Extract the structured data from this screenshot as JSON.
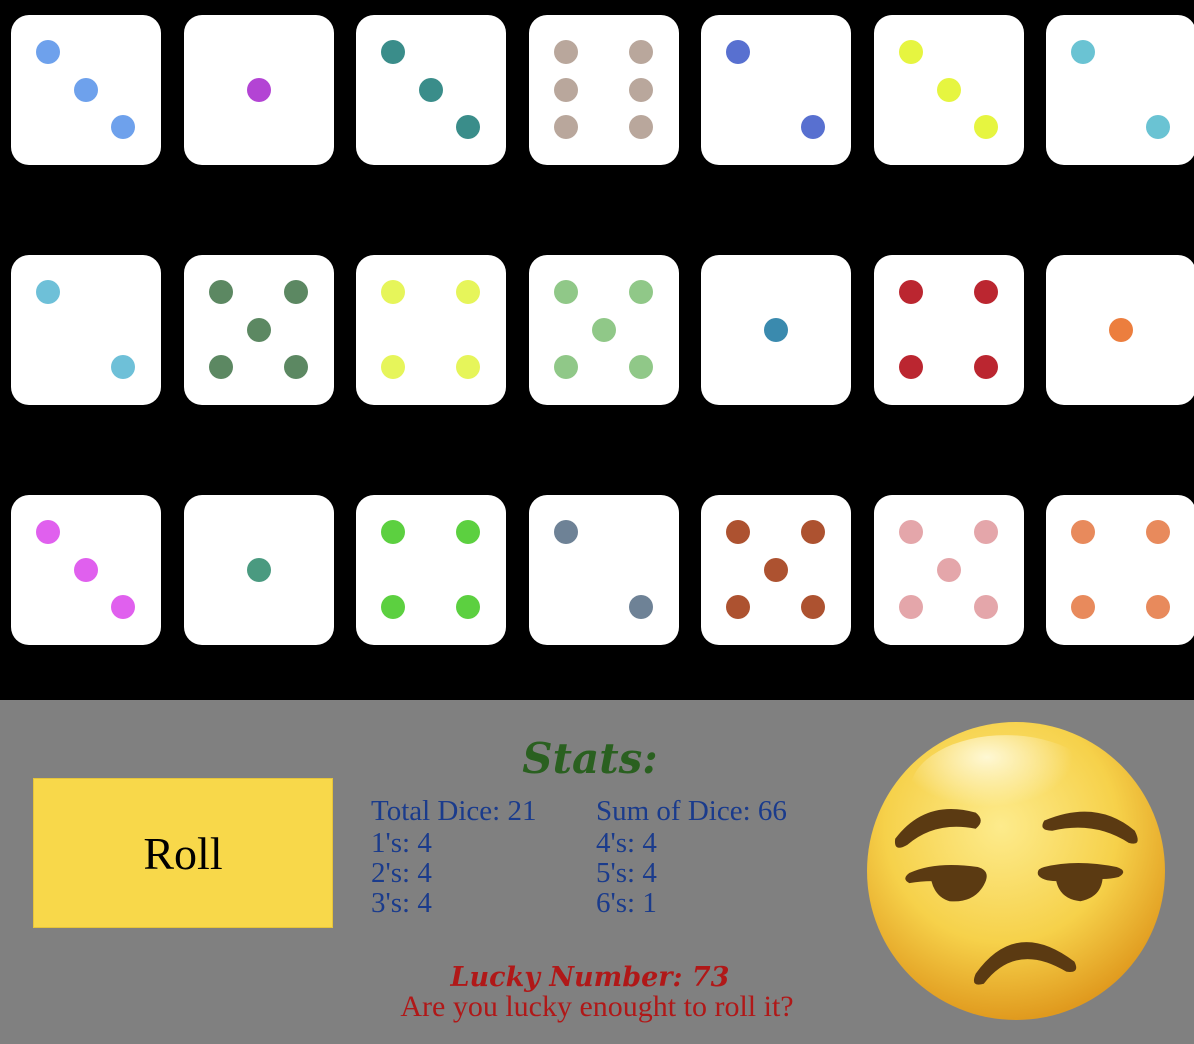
{
  "colors": {
    "board_bg": "#000000",
    "panel_bg": "#808080",
    "die_face": "#ffffff",
    "roll_button": "#f8d84a",
    "stats_title": "#2a6020",
    "stats_text": "#1a3b8c",
    "lucky_text": "#b01818"
  },
  "dice": [
    [
      {
        "value": 3,
        "color": "#6ea1ec"
      },
      {
        "value": 1,
        "color": "#b344d4"
      },
      {
        "value": 3,
        "color": "#3a8d8a"
      },
      {
        "value": 6,
        "color": "#b9a79c"
      },
      {
        "value": 2,
        "color": "#5870d0"
      },
      {
        "value": 3,
        "color": "#e6f540"
      },
      {
        "value": 2,
        "color": "#6ac3d3"
      }
    ],
    [
      {
        "value": 2,
        "color": "#6ec0d8"
      },
      {
        "value": 5,
        "color": "#5c8862"
      },
      {
        "value": 4,
        "color": "#e6f55a"
      },
      {
        "value": 5,
        "color": "#90c888"
      },
      {
        "value": 1,
        "color": "#3a8aae"
      },
      {
        "value": 4,
        "color": "#bb2630"
      },
      {
        "value": 1,
        "color": "#ec7e3e"
      }
    ],
    [
      {
        "value": 3,
        "color": "#e060ee"
      },
      {
        "value": 1,
        "color": "#4a9a80"
      },
      {
        "value": 4,
        "color": "#5cd040"
      },
      {
        "value": 2,
        "color": "#6e8296"
      },
      {
        "value": 5,
        "color": "#ad5230"
      },
      {
        "value": 5,
        "color": "#e4a6aa"
      },
      {
        "value": 4,
        "color": "#e88a5c"
      }
    ]
  ],
  "roll_button": {
    "label": "Roll"
  },
  "stats": {
    "title": "Stats:",
    "total_dice": "Total Dice: 21",
    "sum_of_dice": "Sum of Dice: 66",
    "ones": "1's: 4",
    "twos": "2's: 4",
    "threes": "3's: 4",
    "fours": "4's: 4",
    "fives": "5's: 4",
    "sixes": "6's: 1"
  },
  "lucky": {
    "label": "Lucky Number: 73",
    "question": "Are you lucky enought to roll it?"
  },
  "emoji": {
    "icon": "unamused-face-icon"
  }
}
